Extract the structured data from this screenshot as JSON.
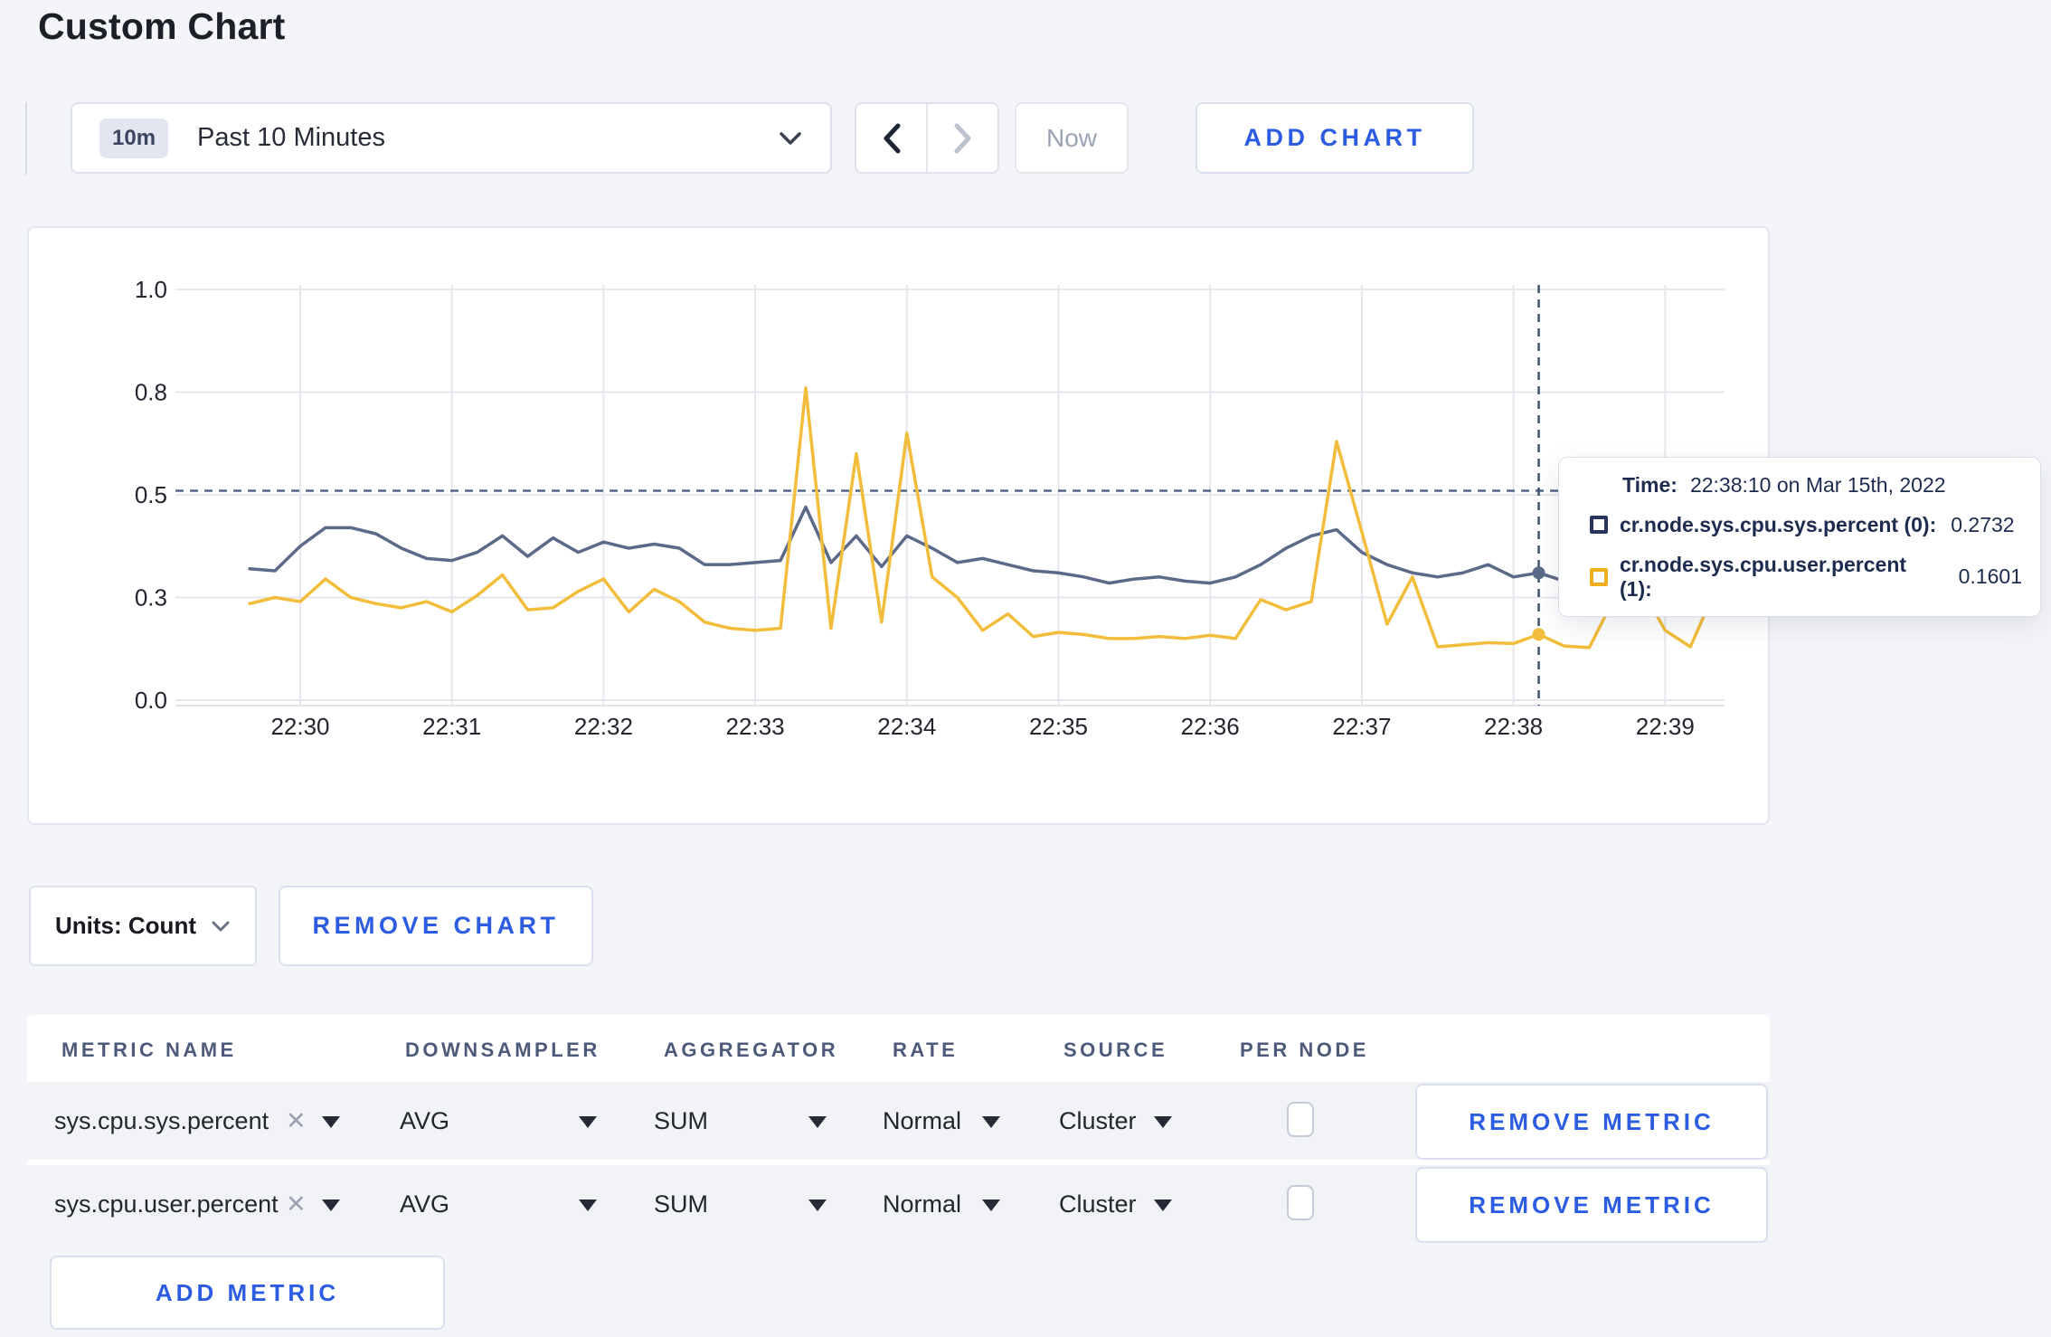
{
  "page": {
    "title": "Custom Chart",
    "background_color": "#f4f5f9"
  },
  "toolbar": {
    "range_badge": "10m",
    "range_label": "Past 10 Minutes",
    "now_label": "Now",
    "add_chart_label": "ADD CHART"
  },
  "chart_data": {
    "type": "line",
    "x_ticks": [
      "22:30",
      "22:31",
      "22:32",
      "22:33",
      "22:34",
      "22:35",
      "22:36",
      "22:37",
      "22:38",
      "22:39"
    ],
    "y_ticks": [
      {
        "value": 1.0,
        "label": "1.0"
      },
      {
        "value": 0.75,
        "label": "0.8"
      },
      {
        "value": 0.5,
        "label": "0.5"
      },
      {
        "value": 0.25,
        "label": "0.3"
      },
      {
        "value": 0.0,
        "label": "0.0"
      }
    ],
    "ylim": [
      0,
      1
    ],
    "grid": true,
    "start_time": "22:29:40",
    "interval_seconds": 10,
    "series": [
      {
        "name": "cr.node.sys.cpu.sys.percent (0)",
        "color": "#5b6a88",
        "values": [
          0.32,
          0.315,
          0.375,
          0.42,
          0.42,
          0.405,
          0.37,
          0.345,
          0.34,
          0.36,
          0.4,
          0.35,
          0.395,
          0.36,
          0.385,
          0.37,
          0.38,
          0.37,
          0.33,
          0.33,
          0.335,
          0.34,
          0.47,
          0.335,
          0.4,
          0.325,
          0.4,
          0.37,
          0.335,
          0.345,
          0.33,
          0.315,
          0.31,
          0.3,
          0.285,
          0.295,
          0.3,
          0.29,
          0.285,
          0.3,
          0.33,
          0.37,
          0.4,
          0.415,
          0.36,
          0.33,
          0.31,
          0.3,
          0.31,
          0.33,
          0.3,
          0.31,
          0.29,
          0.27,
          0.27,
          0.285,
          0.3,
          0.295,
          0.3
        ]
      },
      {
        "name": "cr.node.sys.cpu.user.percent (1)",
        "color": "#f2bd3a",
        "values": [
          0.235,
          0.25,
          0.24,
          0.295,
          0.25,
          0.235,
          0.225,
          0.24,
          0.215,
          0.255,
          0.305,
          0.22,
          0.225,
          0.265,
          0.295,
          0.215,
          0.27,
          0.24,
          0.19,
          0.175,
          0.17,
          0.175,
          0.76,
          0.175,
          0.6,
          0.19,
          0.65,
          0.3,
          0.25,
          0.17,
          0.21,
          0.155,
          0.165,
          0.16,
          0.15,
          0.15,
          0.155,
          0.15,
          0.158,
          0.15,
          0.245,
          0.22,
          0.24,
          0.63,
          0.41,
          0.185,
          0.3,
          0.13,
          0.135,
          0.14,
          0.138,
          0.16,
          0.132,
          0.128,
          0.25,
          0.28,
          0.17,
          0.13,
          0.27
        ]
      }
    ],
    "hover": {
      "index": 51,
      "time": "22:38:10",
      "value_line": 0.51
    }
  },
  "tooltip": {
    "time_label": "Time:",
    "time_value": "22:38:10 on Mar 15th, 2022",
    "entries": [
      {
        "swatch_color": "#26365c",
        "name": "cr.node.sys.cpu.sys.percent (0):",
        "value": "0.2732"
      },
      {
        "swatch_color": "#efb01d",
        "name": "cr.node.sys.cpu.user.percent (1):",
        "value": "0.1601"
      }
    ]
  },
  "chart_controls": {
    "units_label": "Units: Count",
    "remove_chart_label": "REMOVE CHART"
  },
  "metrics_table": {
    "headers": [
      "METRIC NAME",
      "DOWNSAMPLER",
      "AGGREGATOR",
      "RATE",
      "SOURCE",
      "PER NODE"
    ],
    "rows": [
      {
        "metric_name": "sys.cpu.sys.percent",
        "remove_icon": "✕",
        "downsampler": "AVG",
        "aggregator": "SUM",
        "rate": "Normal",
        "source": "Cluster",
        "per_node_checked": false,
        "remove_label": "REMOVE METRIC"
      },
      {
        "metric_name": "sys.cpu.user.percent",
        "remove_icon": "✕",
        "downsampler": "AVG",
        "aggregator": "SUM",
        "rate": "Normal",
        "source": "Cluster",
        "per_node_checked": false,
        "remove_label": "REMOVE METRIC"
      }
    ],
    "add_metric_label": "ADD METRIC"
  }
}
